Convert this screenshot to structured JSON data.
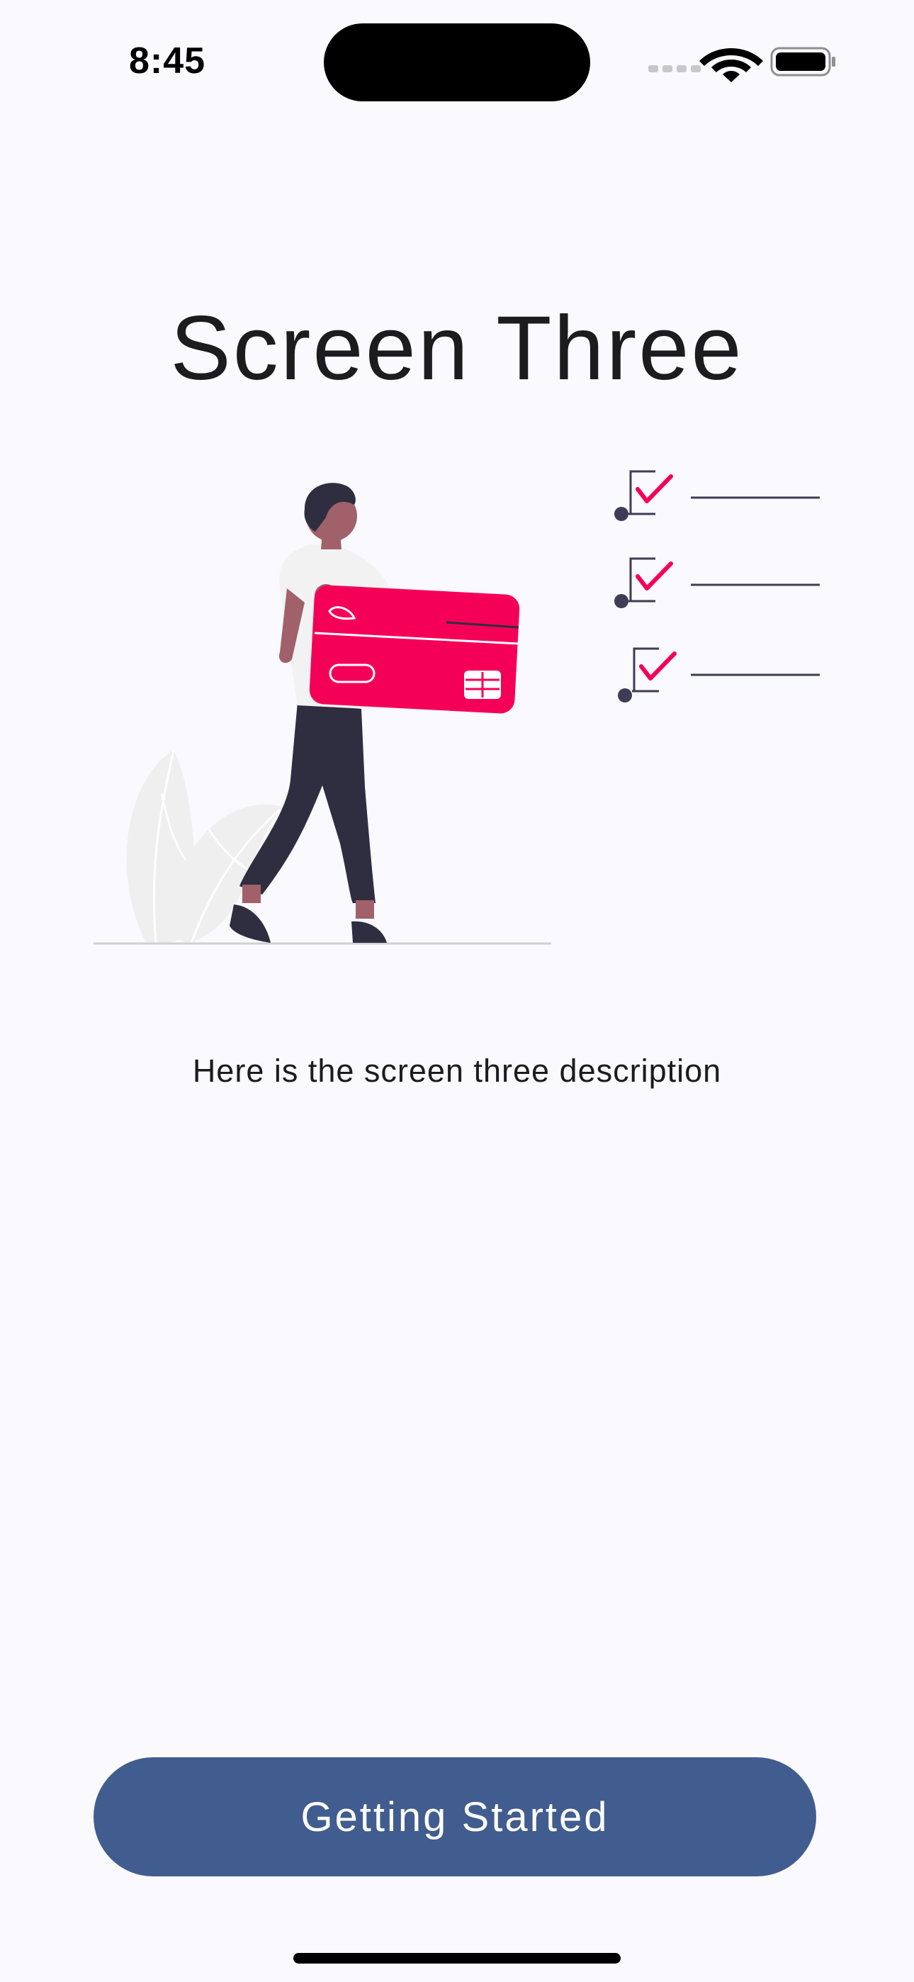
{
  "status_bar": {
    "time": "8:45",
    "signal_icon": "cellular-signal-icon",
    "wifi_icon": "wifi-icon",
    "battery_icon": "battery-icon"
  },
  "onboarding": {
    "title": "Screen Three",
    "description": "Here is the screen three description",
    "illustration": "person-holding-credit-card-illustration",
    "checklist_icon": "checkbox-checked-icon",
    "button_label": "Getting Started"
  },
  "colors": {
    "background": "#f9f9fe",
    "accent": "#f50057",
    "button": "#415d8f",
    "figure_dark": "#2f2e41"
  }
}
